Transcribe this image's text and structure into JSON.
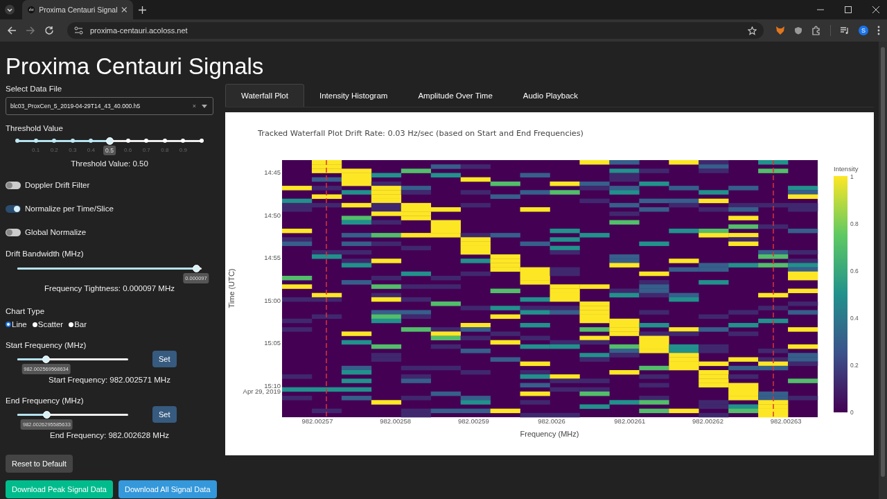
{
  "browser": {
    "tab_title": "Proxima Centauri Signal",
    "url": "proxima-centauri.acoloss.net",
    "profile_initial": "S"
  },
  "page": {
    "title": "Proxima Centauri Signals"
  },
  "file_select": {
    "label": "Select Data File",
    "value": "blc03_ProxCen_5_2019-04-29T14_43_40.000.h5",
    "clear": "×"
  },
  "threshold": {
    "label": "Threshold Value",
    "level": 0.5,
    "marks": [
      "0.1",
      "0.2",
      "0.3",
      "0.4",
      "0.5",
      "0.6",
      "0.7",
      "0.8",
      "0.9"
    ],
    "reading": "Threshold Value: 0.50"
  },
  "toggles": [
    {
      "label": "Doppler Drift Filter",
      "on": false
    },
    {
      "label": "Normalize per Time/Slice",
      "on": true
    },
    {
      "label": "Global Normalize",
      "on": false
    }
  ],
  "drift_bandwidth": {
    "label": "Drift Bandwidth (MHz)",
    "level": 0.97,
    "tooltip": "0.000097",
    "reading": "Frequency Tightness: 0.000097 MHz"
  },
  "chart_type": {
    "label": "Chart Type",
    "options": [
      {
        "label": "Line",
        "selected": true
      },
      {
        "label": "Scatter",
        "selected": false
      },
      {
        "label": "Bar",
        "selected": false
      }
    ]
  },
  "frequencies": [
    {
      "label": "Start Frequency (MHz)",
      "level": 0.26,
      "tooltip": "982.002569568634",
      "button": "Set",
      "reading": "Start Frequency: 982.002571 MHz"
    },
    {
      "label": "End Frequency (MHz)",
      "level": 0.265,
      "tooltip": "982.0026295585633",
      "button": "Set",
      "reading": "End Frequency: 982.002628 MHz"
    }
  ],
  "buttons": [
    {
      "label": "Reset to Default",
      "kind": "neutral"
    },
    {
      "label": "Download Peak Signal Data",
      "kind": "green"
    },
    {
      "label": "Download All Signal Data",
      "kind": "blue"
    }
  ],
  "tabs": [
    {
      "label": "Waterfall Plot",
      "selected": true
    },
    {
      "label": "Intensity Histogram",
      "selected": false
    },
    {
      "label": "Amplitude Over Time",
      "selected": false
    },
    {
      "label": "Audio Playback",
      "selected": false
    }
  ],
  "plot": {
    "title": "Tracked Waterfall Plot Drift Rate: 0.03 Hz/sec (based on Start and End Frequencies)",
    "ylabel": "Time (UTC)",
    "yticks": [
      "14:45",
      "14:50",
      "14:55",
      "15:00",
      "15:05",
      "15:10"
    ],
    "ydate": "Apr 29, 2019",
    "xlabel": "Frequency (MHz)",
    "xticks": [
      "982.00257",
      "982.00258",
      "982.00259",
      "982.0026",
      "982.00261",
      "982.00262",
      "982.00263"
    ],
    "colorbar_title": "Intensity",
    "colorbar_ticks": [
      "1",
      "0.8",
      "0.6",
      "0.4",
      "0.2",
      "0"
    ]
  }
}
